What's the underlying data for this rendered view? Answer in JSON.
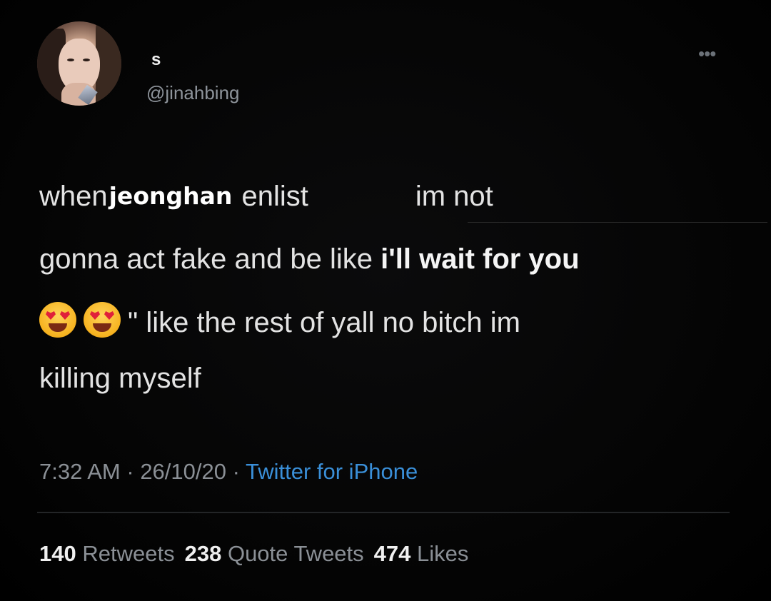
{
  "tweet": {
    "display_name": "s",
    "handle": "@jinahbing",
    "more_icon": "more-options-icon",
    "body": {
      "line1_before": "when",
      "line1_name": "jeonghan",
      "line1_after": " enlist",
      "line1_end": "im not",
      "line2_plain": "gonna act fake and be like ",
      "line2_bold": "i'll wait for you",
      "line3_emoji": "heart-eyes-emoji",
      "line3_text": "\" like the rest of yall no bitch im",
      "line4_text": "killing myself"
    },
    "meta": {
      "time": "7:32 AM",
      "date": "26/10/20",
      "separator": " · ",
      "source": "Twitter for iPhone"
    },
    "stats": {
      "retweets_count": "140",
      "retweets_label": "Retweets",
      "quotes_count": "238",
      "quotes_label": "Quote Tweets",
      "likes_count": "474",
      "likes_label": "Likes"
    }
  },
  "colors": {
    "background": "#000000",
    "text": "#e3e3e3",
    "secondary": "#8b9096",
    "link": "#3a8fd8"
  }
}
